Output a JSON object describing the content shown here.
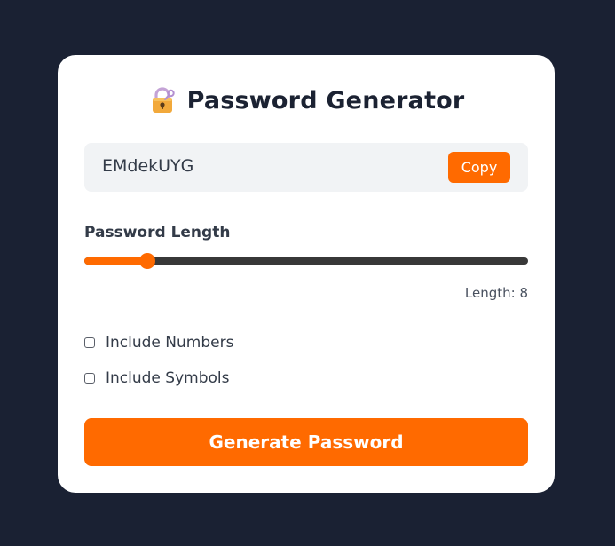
{
  "app": {
    "title": "Password Generator",
    "icon": "locked-with-key-icon"
  },
  "password": {
    "value": "EMdekUYG",
    "copy_label": "Copy"
  },
  "length": {
    "label": "Password Length",
    "value": 8,
    "min": 4,
    "max": 32,
    "readout": "Length: 8"
  },
  "options": {
    "numbers": {
      "label": "Include Numbers",
      "checked": false
    },
    "symbols": {
      "label": "Include Symbols",
      "checked": false
    }
  },
  "generate_label": "Generate Password",
  "colors": {
    "background": "#1a2133",
    "card": "#ffffff",
    "accent": "#ff6a00",
    "track": "#383838",
    "text": "#1b2232"
  }
}
